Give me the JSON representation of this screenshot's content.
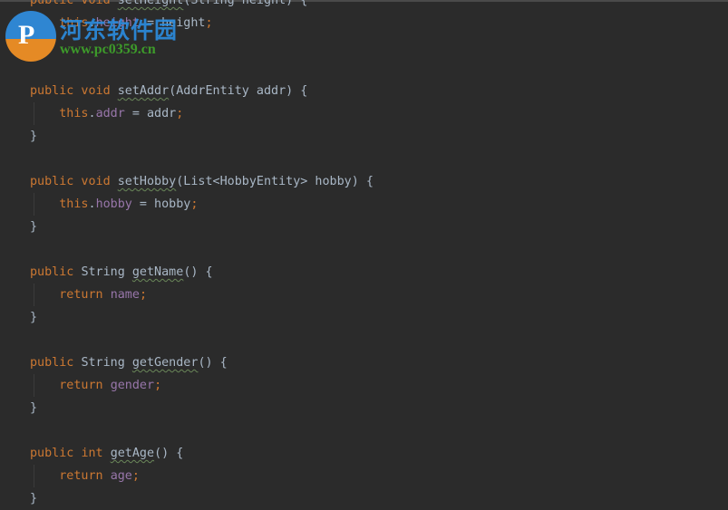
{
  "editor": {
    "colors": {
      "background": "#2b2b2b",
      "keyword": "#cc7832",
      "field": "#9876aa",
      "text": "#a9b7c6"
    },
    "lines": [
      [
        {
          "t": "public void ",
          "c": "kw"
        },
        {
          "t": "setHeight",
          "c": "fn"
        },
        {
          "t": "(String height) {",
          "c": "pl"
        }
      ],
      [
        {
          "t": "    ",
          "c": "pl"
        },
        {
          "t": "this",
          "c": "kw"
        },
        {
          "t": ".",
          "c": "pl"
        },
        {
          "t": "height",
          "c": "fld"
        },
        {
          "t": " = height",
          "c": "pl"
        },
        {
          "t": ";",
          "c": "semi"
        }
      ],
      [
        {
          "t": "}",
          "c": "pl"
        }
      ],
      [],
      [
        {
          "t": "public void ",
          "c": "kw"
        },
        {
          "t": "setAddr",
          "c": "fn"
        },
        {
          "t": "(AddrEntity addr) {",
          "c": "pl"
        }
      ],
      [
        {
          "t": "    ",
          "c": "pl"
        },
        {
          "t": "this",
          "c": "kw"
        },
        {
          "t": ".",
          "c": "pl"
        },
        {
          "t": "addr",
          "c": "fld"
        },
        {
          "t": " = addr",
          "c": "pl"
        },
        {
          "t": ";",
          "c": "semi"
        }
      ],
      [
        {
          "t": "}",
          "c": "pl"
        }
      ],
      [],
      [
        {
          "t": "public void ",
          "c": "kw"
        },
        {
          "t": "setHobby",
          "c": "fn"
        },
        {
          "t": "(List<HobbyEntity> hobby) {",
          "c": "pl"
        }
      ],
      [
        {
          "t": "    ",
          "c": "pl"
        },
        {
          "t": "this",
          "c": "kw"
        },
        {
          "t": ".",
          "c": "pl"
        },
        {
          "t": "hobby",
          "c": "fld"
        },
        {
          "t": " = hobby",
          "c": "pl"
        },
        {
          "t": ";",
          "c": "semi"
        }
      ],
      [
        {
          "t": "}",
          "c": "pl"
        }
      ],
      [],
      [
        {
          "t": "public ",
          "c": "kw"
        },
        {
          "t": "String ",
          "c": "pl"
        },
        {
          "t": "getName",
          "c": "fn"
        },
        {
          "t": "() {",
          "c": "pl"
        }
      ],
      [
        {
          "t": "    ",
          "c": "pl"
        },
        {
          "t": "return ",
          "c": "kw"
        },
        {
          "t": "name",
          "c": "fld"
        },
        {
          "t": ";",
          "c": "semi"
        }
      ],
      [
        {
          "t": "}",
          "c": "pl"
        }
      ],
      [],
      [
        {
          "t": "public ",
          "c": "kw"
        },
        {
          "t": "String ",
          "c": "pl"
        },
        {
          "t": "getGender",
          "c": "fn"
        },
        {
          "t": "() {",
          "c": "pl"
        }
      ],
      [
        {
          "t": "    ",
          "c": "pl"
        },
        {
          "t": "return ",
          "c": "kw"
        },
        {
          "t": "gender",
          "c": "fld"
        },
        {
          "t": ";",
          "c": "semi"
        }
      ],
      [
        {
          "t": "}",
          "c": "pl"
        }
      ],
      [],
      [
        {
          "t": "public ",
          "c": "kw"
        },
        {
          "t": "int ",
          "c": "kw"
        },
        {
          "t": "getAge",
          "c": "fn"
        },
        {
          "t": "() {",
          "c": "pl"
        }
      ],
      [
        {
          "t": "    ",
          "c": "pl"
        },
        {
          "t": "return ",
          "c": "kw"
        },
        {
          "t": "age",
          "c": "fld"
        },
        {
          "t": ";",
          "c": "semi"
        }
      ],
      [
        {
          "t": "}",
          "c": "pl"
        }
      ]
    ]
  },
  "watermark": {
    "title": "河东软件园",
    "url": "www.pc0359.cn"
  }
}
